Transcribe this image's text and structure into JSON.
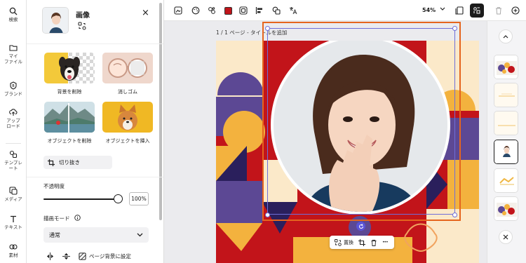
{
  "rail": {
    "items": [
      {
        "label": "検索",
        "icon": "search-icon"
      },
      {
        "label": "マイ\nファイル",
        "icon": "folder-icon"
      },
      {
        "label": "ブランド",
        "icon": "brand-icon"
      },
      {
        "label": "アップ\nロード",
        "icon": "upload-icon"
      },
      {
        "label": "テンプレ\nート",
        "icon": "template-icon"
      },
      {
        "label": "メディア",
        "icon": "media-icon"
      },
      {
        "label": "テキスト",
        "icon": "text-icon"
      },
      {
        "label": "素材",
        "icon": "elements-icon"
      }
    ]
  },
  "panel": {
    "title": "画像",
    "close": "×",
    "tools": [
      {
        "label": "背景を削除"
      },
      {
        "label": "消しゴム"
      },
      {
        "label": "オブジェクトを削除"
      },
      {
        "label": "オブジェクトを挿入"
      }
    ],
    "crop_label": "切り抜き",
    "opacity_label": "不透明度",
    "opacity_value": "100%",
    "opacity_level": 1.0,
    "blend_label": "描画モード",
    "blend_value": "通常",
    "page_bg_label": "ページ背景に設定"
  },
  "toolbar": {
    "zoom": "54%"
  },
  "canvas": {
    "page_title": "1 / 1 ページ - タイトルを追加",
    "context_replace": "置換",
    "context_more": "•••"
  },
  "colors": {
    "accent_orange": "#e5651e",
    "selection_blue": "#6f6ed8",
    "artboard_red": "#c2141a",
    "color_chip": "#c0141a"
  }
}
